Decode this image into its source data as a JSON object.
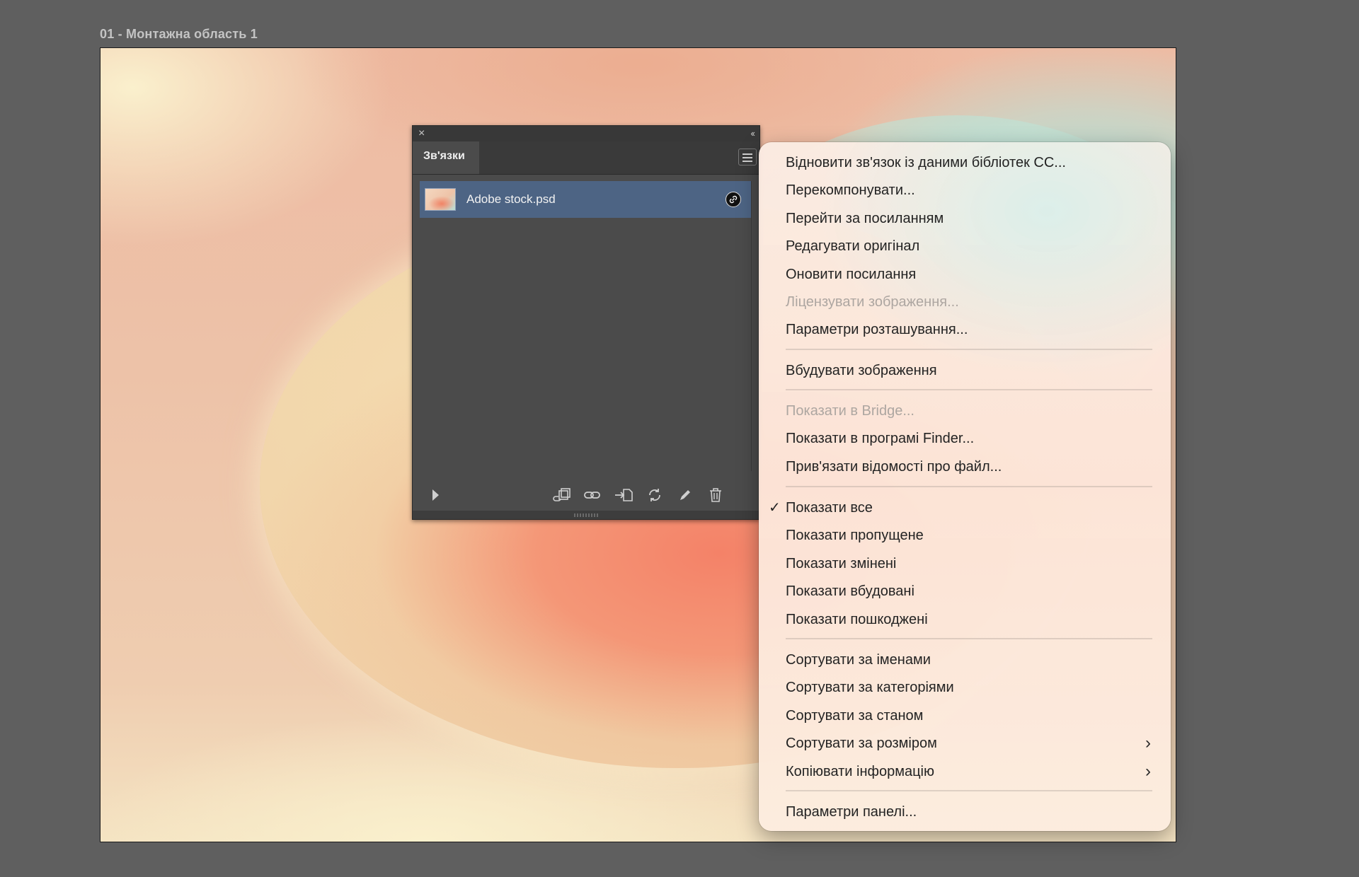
{
  "artboard": {
    "label": "01 - Монтажна область 1"
  },
  "links_panel": {
    "close_icon": "×",
    "collapse_icon": "‹‹",
    "tab_label": "Зв'язки",
    "menu_icon": "hamburger-icon",
    "items": [
      {
        "name": "Adobe stock.psd",
        "status_icon": "link-icon"
      }
    ],
    "toolbar": [
      "play-icon",
      "relink-from-libraries-icon",
      "relink-icon",
      "go-to-link-icon",
      "update-link-icon",
      "edit-original-icon",
      "delete-icon"
    ]
  },
  "context_menu": {
    "groups": [
      [
        {
          "label": "Відновити зв'язок із даними бібліотек CC...",
          "enabled": true
        },
        {
          "label": "Перекомпонувати...",
          "enabled": true
        },
        {
          "label": "Перейти за посиланням",
          "enabled": true
        },
        {
          "label": "Редагувати оригінал",
          "enabled": true
        },
        {
          "label": "Оновити посилання",
          "enabled": true
        },
        {
          "label": "Ліцензувати зображення...",
          "enabled": false
        },
        {
          "label": "Параметри розташування...",
          "enabled": true
        }
      ],
      [
        {
          "label": "Вбудувати зображення",
          "enabled": true
        }
      ],
      [
        {
          "label": "Показати в Bridge...",
          "enabled": false
        },
        {
          "label": "Показати в програмі Finder...",
          "enabled": true
        },
        {
          "label": "Прив'язати відомості про файл...",
          "enabled": true
        }
      ],
      [
        {
          "label": "Показати все",
          "enabled": true,
          "checked": true
        },
        {
          "label": "Показати пропущене",
          "enabled": true
        },
        {
          "label": "Показати змінені",
          "enabled": true
        },
        {
          "label": "Показати вбудовані",
          "enabled": true
        },
        {
          "label": "Показати пошкоджені",
          "enabled": true
        }
      ],
      [
        {
          "label": "Сортувати за іменами",
          "enabled": true
        },
        {
          "label": "Сортувати за категоріями",
          "enabled": true
        },
        {
          "label": "Сортувати за станом",
          "enabled": true
        },
        {
          "label": "Сортувати за розміром",
          "enabled": true,
          "submenu": true
        },
        {
          "label": "Копіювати інформацію",
          "enabled": true,
          "submenu": true
        }
      ],
      [
        {
          "label": "Параметри панелі...",
          "enabled": true
        }
      ]
    ],
    "check_glyph": "✓",
    "chevron_glyph": "›"
  },
  "colors": {
    "panel_bg": "#4b4b4b",
    "selected_row": "#4d6484",
    "menu_text": "#232323",
    "menu_disabled_text": "#ada6a1"
  }
}
